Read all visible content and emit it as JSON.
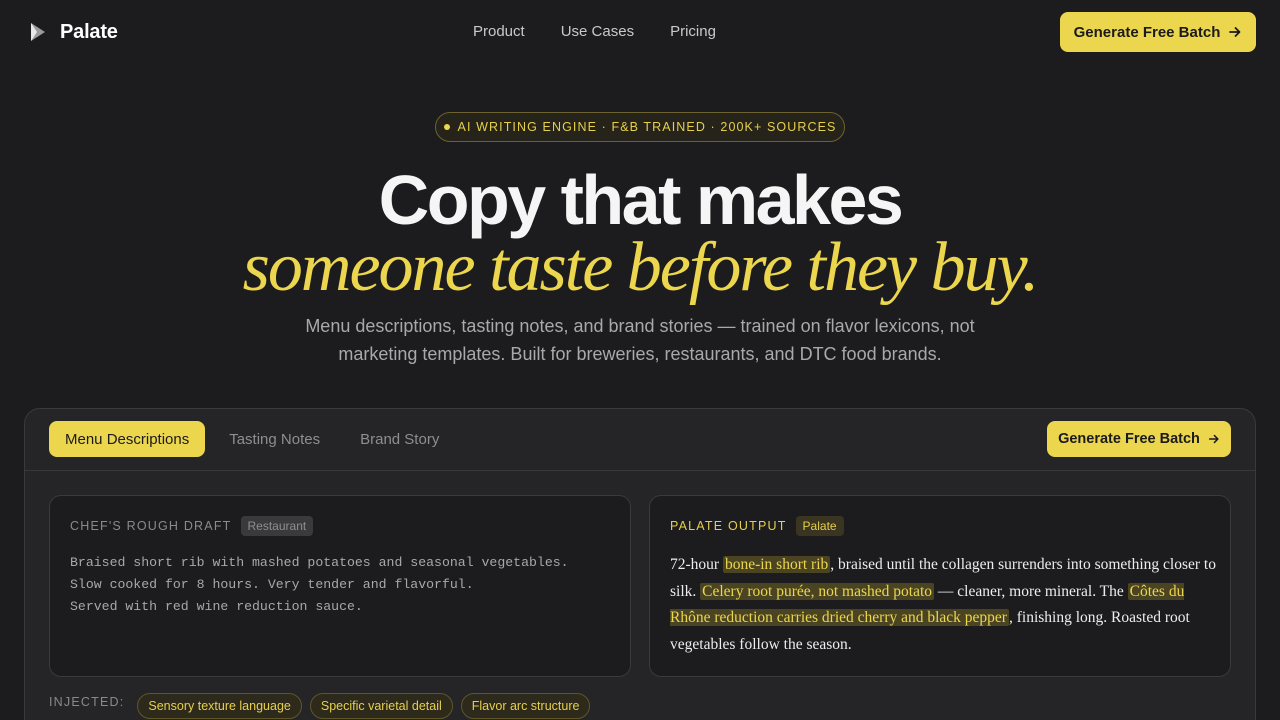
{
  "nav": {
    "brand": "Palate",
    "links": [
      "Product",
      "Use Cases",
      "Pricing"
    ],
    "cta": "Generate Free Batch"
  },
  "hero": {
    "badge": "AI WRITING ENGINE · F&B TRAINED · 200K+ SOURCES",
    "title_line1": "Copy that makes",
    "title_line2": "someone taste before they buy.",
    "subtitle": "Menu descriptions, tasting notes, and brand stories — trained on flavor lexicons, not marketing templates. Built for breweries, restaurants, and DTC food brands."
  },
  "demo": {
    "tabs": [
      "Menu Descriptions",
      "Tasting Notes",
      "Brand Story"
    ],
    "active_tab": 0,
    "cta": "Generate Free Batch",
    "draft": {
      "label": "CHEF'S ROUGH DRAFT",
      "tag": "Restaurant",
      "lines": [
        "Braised short rib with mashed potatoes and seasonal vegetables.",
        "Slow cooked for 8 hours. Very tender and flavorful.",
        "Served with red wine reduction sauce."
      ]
    },
    "output": {
      "label": "PALATE OUTPUT",
      "tag": "Palate",
      "segments": [
        {
          "text": "72-hour ",
          "highlight": false
        },
        {
          "text": "bone-in short rib",
          "highlight": true
        },
        {
          "text": ", braised until the collagen surrenders into something closer to silk. ",
          "highlight": false
        },
        {
          "text": "Celery root purée, not mashed potato",
          "highlight": true
        },
        {
          "text": " — cleaner, more mineral. The ",
          "highlight": false
        },
        {
          "text": "Côtes du Rhône reduction carries dried cherry and black pepper",
          "highlight": true
        },
        {
          "text": ", finishing long. Roasted root vegetables follow the season.",
          "highlight": false
        }
      ]
    },
    "injected": {
      "label": "INJECTED:",
      "chips": [
        "Sensory texture language",
        "Specific varietal detail",
        "Flavor arc structure"
      ]
    }
  },
  "colors": {
    "background": "#1c1c1e",
    "accent": "#ecd64e",
    "panel": "#252527"
  },
  "icons": {
    "brand": "play-wedge-logo-icon",
    "cta": "arrow-right-icon"
  }
}
